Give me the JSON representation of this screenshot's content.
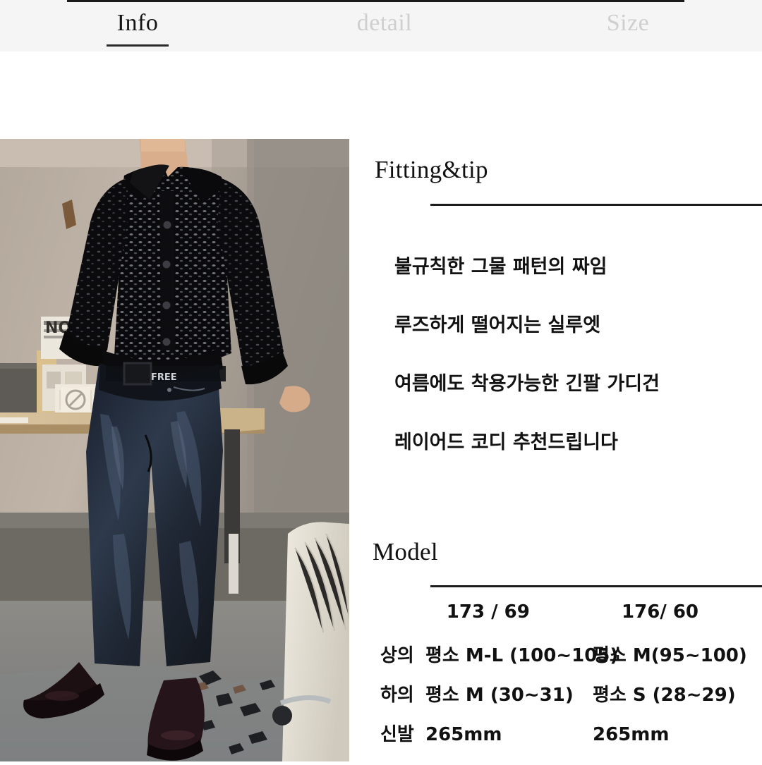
{
  "tabs": [
    {
      "label": "Info",
      "state": "active",
      "icon": "tab-info"
    },
    {
      "label": "detail",
      "state": "inactive",
      "icon": "tab-detail"
    },
    {
      "label": "Size",
      "state": "inactive",
      "icon": "tab-size"
    }
  ],
  "colors": {
    "header_bg": "#f5f5f5",
    "active_text": "#141414",
    "inactive_text": "#cfcfcf",
    "rule": "#1c1c1c",
    "body_text": "#121212",
    "page_bg": "#ffffff"
  },
  "product_photo": {
    "alt": "model wearing black open-knit crochet cardigan with dark wide-leg jeans standing in an office"
  },
  "fitting": {
    "heading": "Fitting&tip",
    "lines": [
      "불규칙한 그물 패턴의 짜임",
      "루즈하게 떨어지는 실루엣",
      "여름에도 착용가능한 긴팔 가디건",
      "레이어드 코디 추천드립니다"
    ]
  },
  "model": {
    "heading": "Model",
    "columns": [
      "173 / 69",
      "176/ 60"
    ],
    "rows": [
      {
        "label": "상의",
        "values": [
          "평소 M-L (100~105)",
          "평소 M(95~100)"
        ]
      },
      {
        "label": "하의",
        "values": [
          "평소 M (30~31)",
          "평소 S (28~29)"
        ]
      },
      {
        "label": "신발",
        "values": [
          "265mm",
          "265mm"
        ]
      }
    ]
  }
}
